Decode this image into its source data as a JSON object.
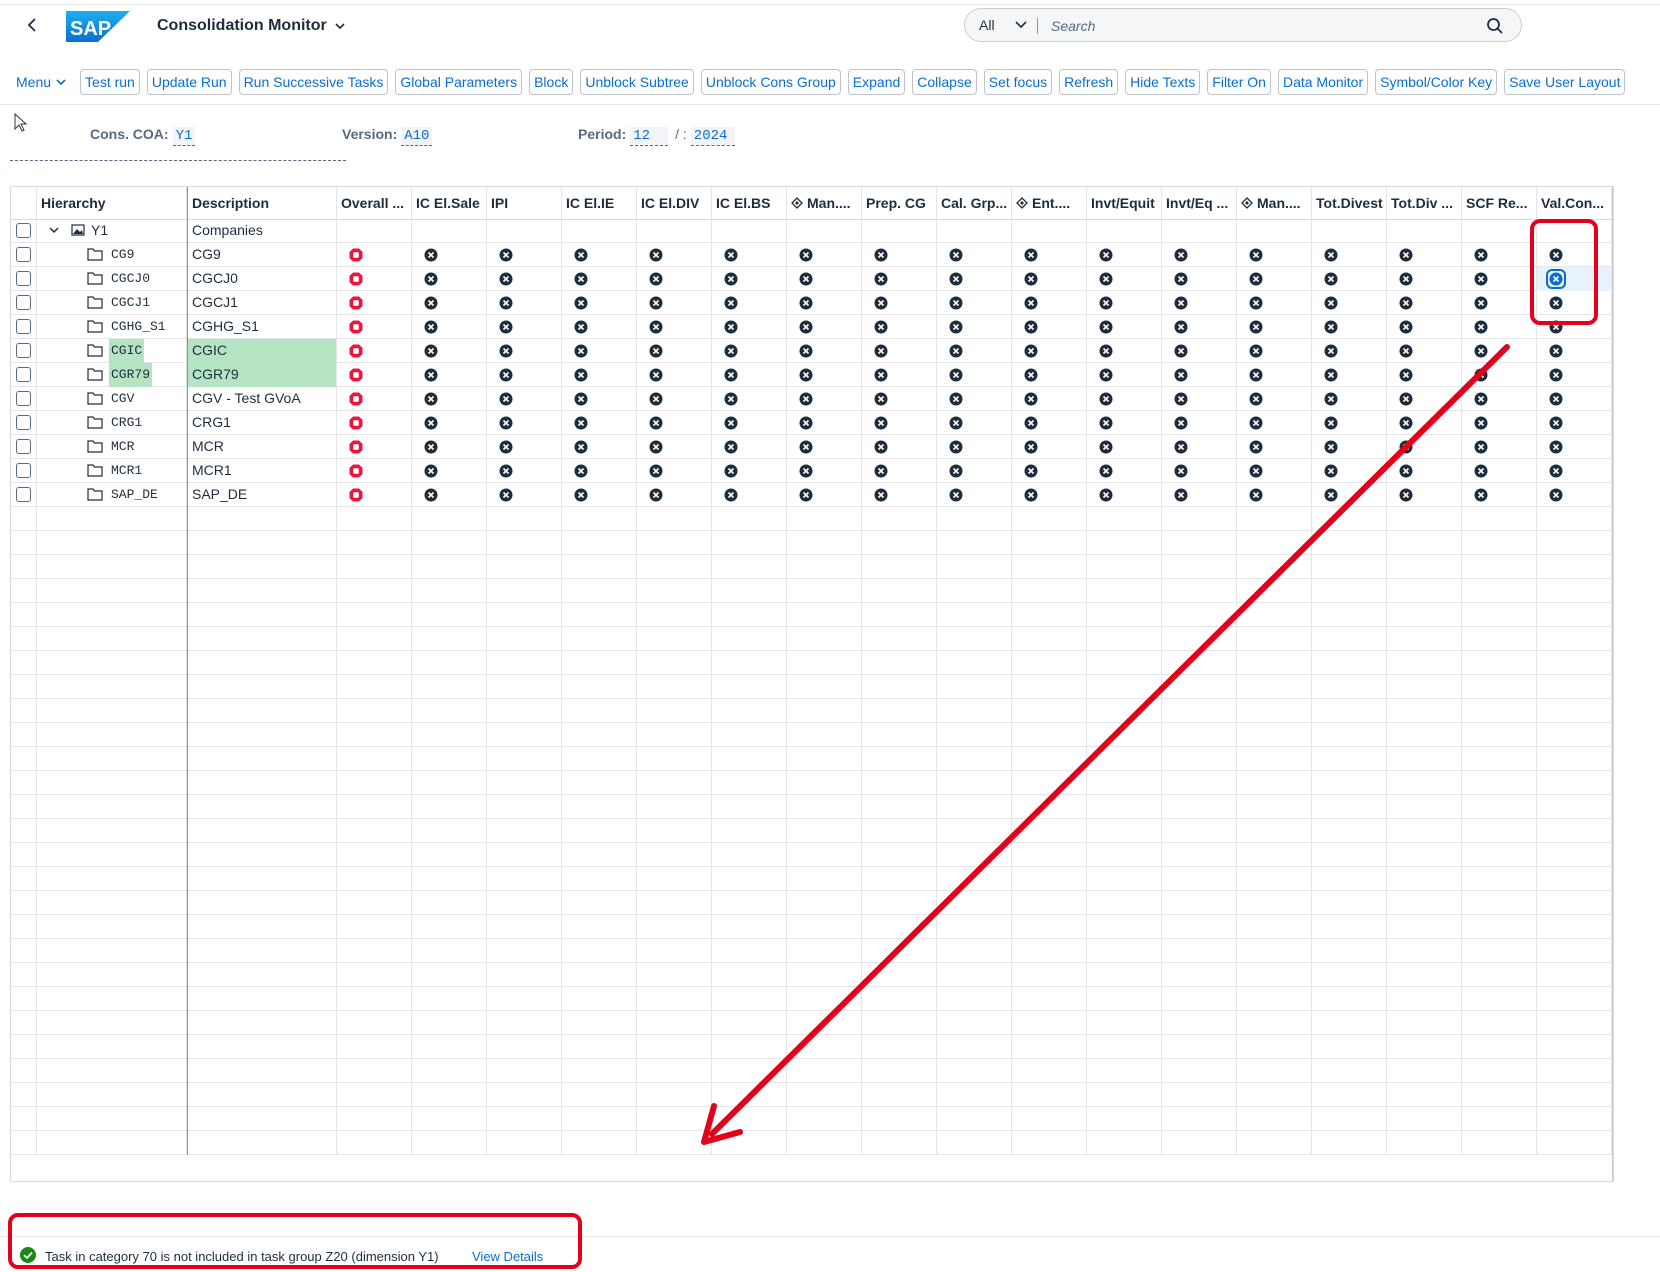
{
  "shell": {
    "app_title": "Consolidation Monitor",
    "search_scope": "All",
    "search_placeholder": "Search"
  },
  "toolbar": {
    "menu_label": "Menu",
    "buttons": [
      "Test run",
      "Update Run",
      "Run Successive Tasks",
      "Global Parameters",
      "Block",
      "Unblock Subtree",
      "Unblock Cons Group",
      "Expand",
      "Collapse",
      "Set focus",
      "Refresh",
      "Hide Texts",
      "Filter On",
      "Data Monitor",
      "Symbol/Color Key",
      "Save User Layout"
    ]
  },
  "filters": {
    "coa_label": "Cons. COA:",
    "coa_value": "Y1",
    "version_label": "Version:",
    "version_value": "A10",
    "period_label": "Period:",
    "period_value": "12",
    "period_sep": "/ :",
    "year_value": "2024"
  },
  "grid": {
    "columns": [
      "Hierarchy",
      "Description",
      "Overall ...",
      "IC El.Sale",
      "IPI",
      "IC El.IE",
      "IC El.DIV",
      "IC El.BS",
      "Man....",
      "Prep. CG",
      "Cal. Grp...",
      "Ent....",
      "Invt/Equit",
      "Invt/Eq ...",
      "Man....",
      "Tot.Divest",
      "Tot.Div ...",
      "SCF Re...",
      "Val.Con..."
    ],
    "root": {
      "node": "Y1",
      "description": "Companies"
    },
    "rows": [
      {
        "node": "CG9",
        "description": "CG9"
      },
      {
        "node": "CGCJ0",
        "description": "CGCJ0"
      },
      {
        "node": "CGCJ1",
        "description": "CGCJ1"
      },
      {
        "node": "CGHG_S1",
        "description": "CGHG_S1"
      },
      {
        "node": "CGIC",
        "description": "CGIC"
      },
      {
        "node": "CGR79",
        "description": "CGR79"
      },
      {
        "node": "CGV",
        "description": "CGV - Test GVoA"
      },
      {
        "node": "CRG1",
        "description": "CRG1"
      },
      {
        "node": "MCR",
        "description": "MCR"
      },
      {
        "node": "MCR1",
        "description": "MCR1"
      },
      {
        "node": "SAP_DE",
        "description": "SAP_DE"
      }
    ]
  },
  "status": {
    "message": "Task in category 70 is not included in task group Z20 (dimension Y1)",
    "link": "View Details"
  }
}
